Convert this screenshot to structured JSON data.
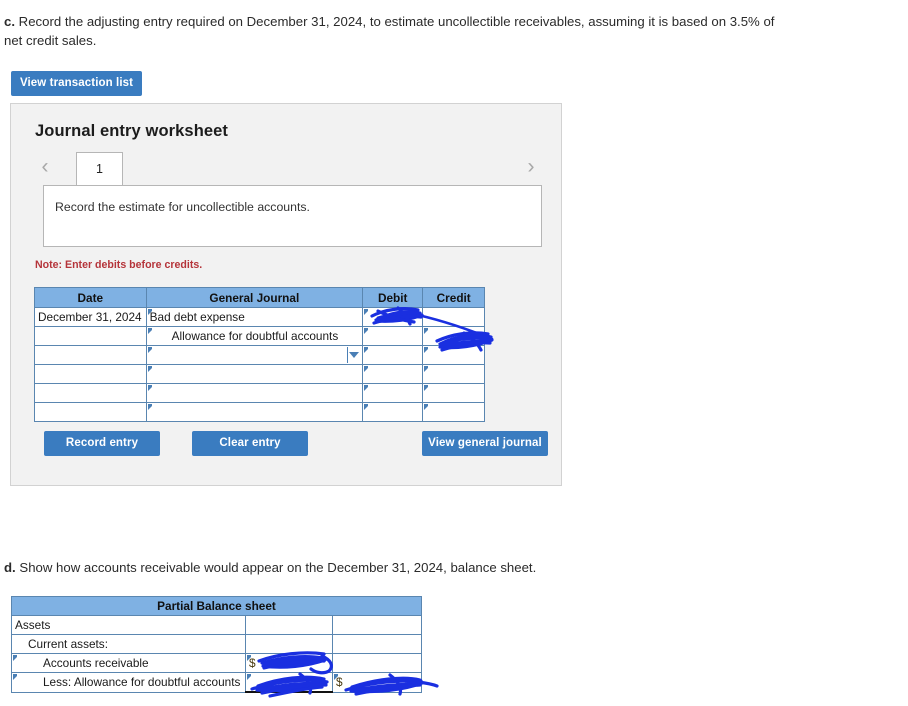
{
  "question_c": {
    "label": "c.",
    "text": "Record the adjusting entry required on December 31, 2024, to estimate uncollectible receivables, assuming it is based on 3.5% of net credit sales."
  },
  "view_transaction_button": "View transaction list",
  "worksheet": {
    "title": "Journal entry worksheet",
    "prev_arrow": "‹",
    "next_arrow": "›",
    "tabs": [
      "1"
    ],
    "active_tab": "1",
    "instruction": "Record the estimate for uncollectible accounts.",
    "note": "Note: Enter debits before credits.",
    "table": {
      "headers": [
        "Date",
        "General Journal",
        "Debit",
        "Credit"
      ],
      "rows": [
        {
          "date": "December 31, 2024",
          "account": "Bad debt expense",
          "indent": 0,
          "debit": "",
          "credit": "",
          "dropdown": false
        },
        {
          "date": "",
          "account": "Allowance for doubtful accounts",
          "indent": 1,
          "debit": "",
          "credit": "",
          "dropdown": false
        },
        {
          "date": "",
          "account": "",
          "indent": 0,
          "debit": "",
          "credit": "",
          "dropdown": true
        },
        {
          "date": "",
          "account": "",
          "indent": 0,
          "debit": "",
          "credit": "",
          "dropdown": false
        },
        {
          "date": "",
          "account": "",
          "indent": 0,
          "debit": "",
          "credit": "",
          "dropdown": false
        },
        {
          "date": "",
          "account": "",
          "indent": 0,
          "debit": "",
          "credit": "",
          "dropdown": false
        }
      ]
    },
    "buttons": {
      "record": "Record entry",
      "clear": "Clear entry",
      "view_journal": "View general journal"
    }
  },
  "question_d": {
    "label": "d.",
    "text": "Show how accounts receivable would appear on the December 31, 2024, balance sheet."
  },
  "balance_sheet": {
    "title": "Partial Balance sheet",
    "rows": [
      {
        "label": "Assets",
        "indent": 0,
        "col1": "",
        "col2": "",
        "editable": false
      },
      {
        "label": "Current assets:",
        "indent": 1,
        "col1": "",
        "col2": "",
        "editable": false
      },
      {
        "label": "Accounts receivable",
        "indent": 2,
        "col1": "$",
        "col2": "",
        "editable": true
      },
      {
        "label": "Less: Allowance for doubtful accounts",
        "indent": 2,
        "col1": "",
        "col2": "$",
        "editable": true
      }
    ]
  },
  "colors": {
    "button_blue": "#3a7cc0",
    "table_header_blue": "#7fb1e3",
    "table_border_blue": "#5a86b0",
    "panel_gray": "#f2f2f2",
    "note_red": "#b5343a",
    "ink_blue": "#1a2fe0"
  },
  "annotations": {
    "description": "hand-drawn blue pen scribbles obscuring entered amounts",
    "marks": [
      "debit-amount-scribble",
      "credit-amount-scribble",
      "ar-amount-scribble",
      "allowance-amount-scribble",
      "net-ar-amount-scribble"
    ]
  }
}
